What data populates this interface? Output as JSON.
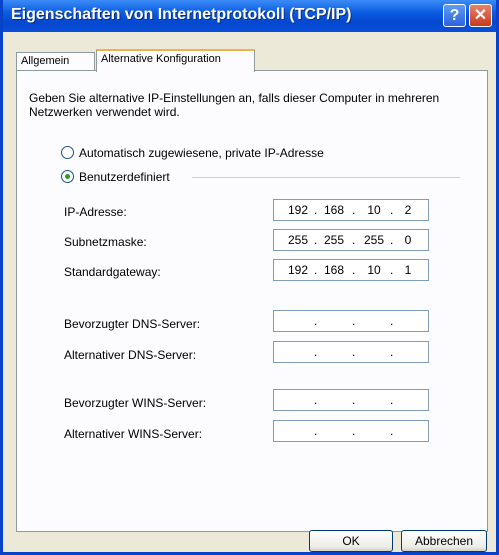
{
  "window": {
    "title": "Eigenschaften von Internetprotokoll (TCP/IP)",
    "help_label": "?",
    "close_label": "✕"
  },
  "tabs": [
    {
      "label": "Allgemein",
      "active": false
    },
    {
      "label": "Alternative Konfiguration",
      "active": true
    }
  ],
  "description": "Geben Sie alternative IP-Einstellungen an, falls dieser Computer in mehreren Netzwerken verwendet wird.",
  "options": {
    "auto_label": "Automatisch zugewiesene, private IP-Adresse",
    "custom_label": "Benutzerdefiniert",
    "selected": "custom"
  },
  "fields": [
    {
      "label": "IP-Adresse:",
      "octets": [
        "192",
        "168",
        "10",
        "2"
      ]
    },
    {
      "label": "Subnetzmaske:",
      "octets": [
        "255",
        "255",
        "255",
        "0"
      ]
    },
    {
      "label": "Standardgateway:",
      "octets": [
        "192",
        "168",
        "10",
        "1"
      ]
    },
    {
      "label": "Bevorzugter DNS-Server:",
      "octets": [
        "",
        "",
        "",
        ""
      ]
    },
    {
      "label": "Alternativer DNS-Server:",
      "octets": [
        "",
        "",
        "",
        ""
      ]
    },
    {
      "label": "Bevorzugter WINS-Server:",
      "octets": [
        "",
        "",
        "",
        ""
      ]
    },
    {
      "label": "Alternativer WINS-Server:",
      "octets": [
        "",
        "",
        "",
        ""
      ]
    }
  ],
  "buttons": {
    "ok_label": "OK",
    "cancel_label": "Abbrechen"
  }
}
